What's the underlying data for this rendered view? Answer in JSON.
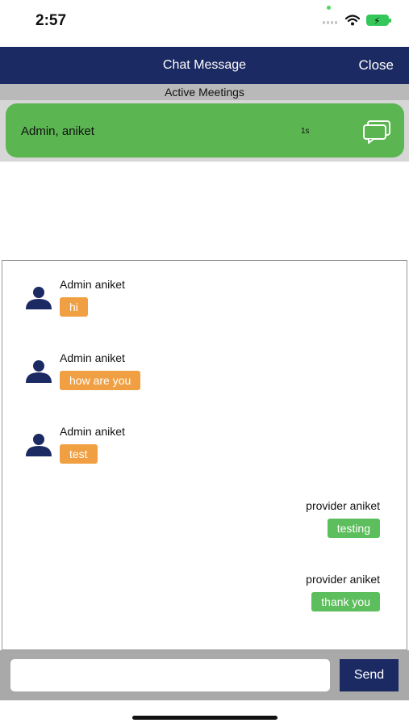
{
  "status_bar": {
    "time": "2:57"
  },
  "header": {
    "title": "Chat Message",
    "close_label": "Close"
  },
  "meetings": {
    "section_title": "Active Meetings",
    "items": [
      {
        "name": "Admin, aniket",
        "time": "1s"
      }
    ]
  },
  "chat": {
    "messages": [
      {
        "sender": "Admin aniket",
        "text": "hi",
        "side": "left"
      },
      {
        "sender": "Admin aniket",
        "text": "how are you",
        "side": "left"
      },
      {
        "sender": "Admin aniket",
        "text": "test",
        "side": "left"
      },
      {
        "sender": "provider  aniket",
        "text": "testing",
        "side": "right"
      },
      {
        "sender": "provider  aniket",
        "text": "thank you",
        "side": "right"
      }
    ]
  },
  "composer": {
    "input_value": "",
    "placeholder": "",
    "send_label": "Send"
  },
  "colors": {
    "header_bg": "#1b2a63",
    "meeting_card": "#5bb551",
    "incoming_bubble": "#f0a043",
    "outgoing_bubble": "#5cbe5c",
    "avatar": "#1b2a63"
  }
}
